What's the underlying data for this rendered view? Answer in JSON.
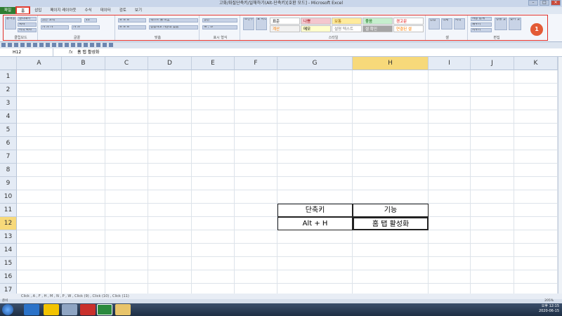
{
  "window": {
    "title": "고화/화질단축키/일해하기(Alt-단축키)[호환 모드] - Microsoft Excel"
  },
  "tabs": [
    "파일",
    "홈",
    "삽입",
    "페이지 레이아웃",
    "수식",
    "데이터",
    "검토",
    "보기"
  ],
  "ribbon": {
    "clipboard_label": "클립보드",
    "paste_label": "붙여넣기",
    "cut_label": "잘라내기",
    "copy_label": "복사",
    "format_painter_label": "서식 복사",
    "font_name": "맑은 고딕",
    "font_size": "11",
    "font_label": "글꼴",
    "alignment_label": "맞춤",
    "wrap_text_label": "텍스트 줄 바꿈",
    "merge_label": "병합하고 가운데 맞춤",
    "number_format": "일반",
    "number_label": "표시 형식",
    "conditional_label": "조건부 서식",
    "table_label": "표 서식",
    "styles_label": "스타일",
    "cells_label": "셀",
    "insert_label": "삽입",
    "delete_label": "삭제",
    "format_label": "서식",
    "editing_label": "편집",
    "autosum_label": "자동 합계",
    "fill_label": "채우기",
    "clear_label": "지우기",
    "sort_label": "정렬 및 필터",
    "find_label": "찾기 및 선택",
    "styles": [
      {
        "label": "표준",
        "bg": "#ffffff",
        "color": "#000000"
      },
      {
        "label": "나쁨",
        "bg": "#f4c7ce",
        "color": "#9c0006"
      },
      {
        "label": "보통",
        "bg": "#ffeb9c",
        "color": "#9c6500"
      },
      {
        "label": "좋음",
        "bg": "#c6efce",
        "color": "#006100"
      },
      {
        "label": "경고문",
        "bg": "#ffffff",
        "color": "#e00000"
      },
      {
        "label": "계산",
        "bg": "#f2f2f2",
        "color": "#fa7d00"
      },
      {
        "label": "메모",
        "bg": "#ffffcc",
        "color": "#000000"
      },
      {
        "label": "설명 텍스트",
        "bg": "#ffffff",
        "color": "#7f7f7f"
      },
      {
        "label": "셀 확인",
        "bg": "#a5a5a5",
        "color": "#ffffff"
      },
      {
        "label": "연결된 셀",
        "bg": "#ffffff",
        "color": "#fa7d00"
      }
    ],
    "badge": "1"
  },
  "formula_bar": {
    "name_box": "H12",
    "fx": "fx",
    "content": "홈 탭 활성화"
  },
  "columns": [
    "A",
    "B",
    "C",
    "D",
    "E",
    "F",
    "G",
    "H",
    "I",
    "J",
    "K"
  ],
  "rows": [
    "1",
    "2",
    "3",
    "4",
    "5",
    "6",
    "7",
    "8",
    "9",
    "10",
    "11",
    "12",
    "13",
    "14",
    "15",
    "16",
    "17"
  ],
  "table": {
    "header": [
      "단축키",
      "기능"
    ],
    "row": [
      "Alt + H",
      "홈 탭 활성화"
    ]
  },
  "sheet_tabs": "Click , A , F , H , M , N , P , W , Click (9) , Click (10) , Click (11)",
  "status": {
    "ready": "준비",
    "zoom": "205%"
  },
  "clock": {
    "time": "오후 12:15",
    "date": "2020-06-15"
  }
}
